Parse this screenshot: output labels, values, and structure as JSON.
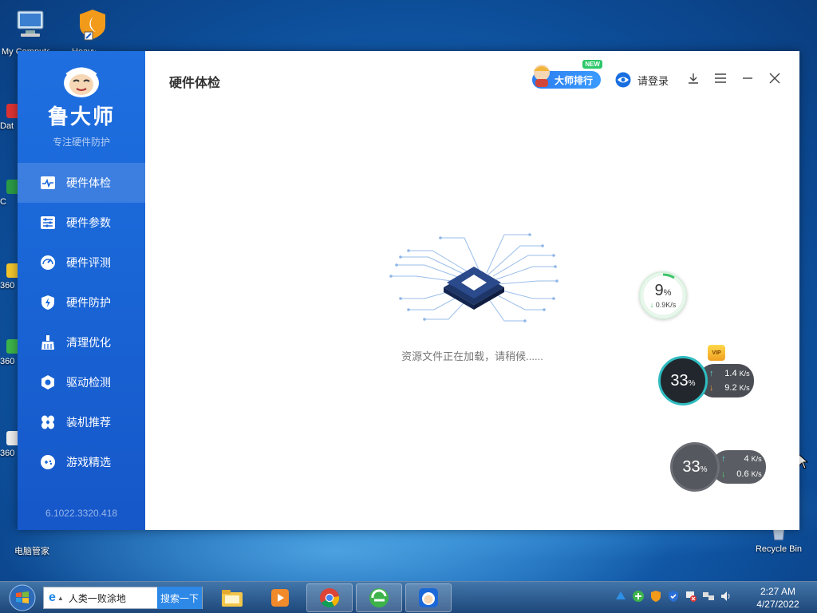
{
  "desktop": {
    "icons": [
      {
        "label": "My Computer"
      },
      {
        "label": "Heavy"
      },
      {
        "label": "电脑管家"
      },
      {
        "label": "Recycle Bin"
      }
    ],
    "peek_labels": [
      "Dat",
      "C",
      "360",
      "360",
      "360"
    ]
  },
  "app": {
    "brand_name": "鲁大师",
    "brand_tagline": "专注硬件防护",
    "version": "6.1022.3320.418",
    "page_title": "硬件体检",
    "nav": [
      {
        "label": "硬件体检",
        "icon": "pulse-monitor-icon",
        "active": true
      },
      {
        "label": "硬件参数",
        "icon": "sliders-icon",
        "active": false
      },
      {
        "label": "硬件评测",
        "icon": "gauge-icon",
        "active": false
      },
      {
        "label": "硬件防护",
        "icon": "lightning-shield-icon",
        "active": false
      },
      {
        "label": "清理优化",
        "icon": "broom-icon",
        "active": false
      },
      {
        "label": "驱动检测",
        "icon": "hexagon-gear-icon",
        "active": false
      },
      {
        "label": "装机推荐",
        "icon": "fan-icon",
        "active": false
      },
      {
        "label": "游戏精选",
        "icon": "gamepad-icon",
        "active": false
      }
    ],
    "topbar": {
      "rank_label": "大师排行",
      "new_badge": "NEW",
      "login_label": "请登录"
    },
    "loading_text": "资源文件正在加载，请稍候......",
    "accent_color": "#1a67d8"
  },
  "monitors": {
    "small": {
      "percent": "9",
      "unit": "%",
      "down": "0.9K/s"
    },
    "dark": {
      "percent": "33",
      "unit": "%",
      "up": "1.4",
      "up_unit": "K/s",
      "down": "9.2",
      "down_unit": "K/s",
      "badge": "VIP"
    },
    "gray": {
      "percent": "33",
      "unit": "%",
      "up": "4",
      "up_unit": "K/s",
      "down": "0.6",
      "down_unit": "K/s"
    }
  },
  "taskbar": {
    "search_text": "人类一败涂地",
    "search_button": "搜索一下",
    "clock_time": "2:27 AM",
    "clock_date": "4/27/2022"
  }
}
